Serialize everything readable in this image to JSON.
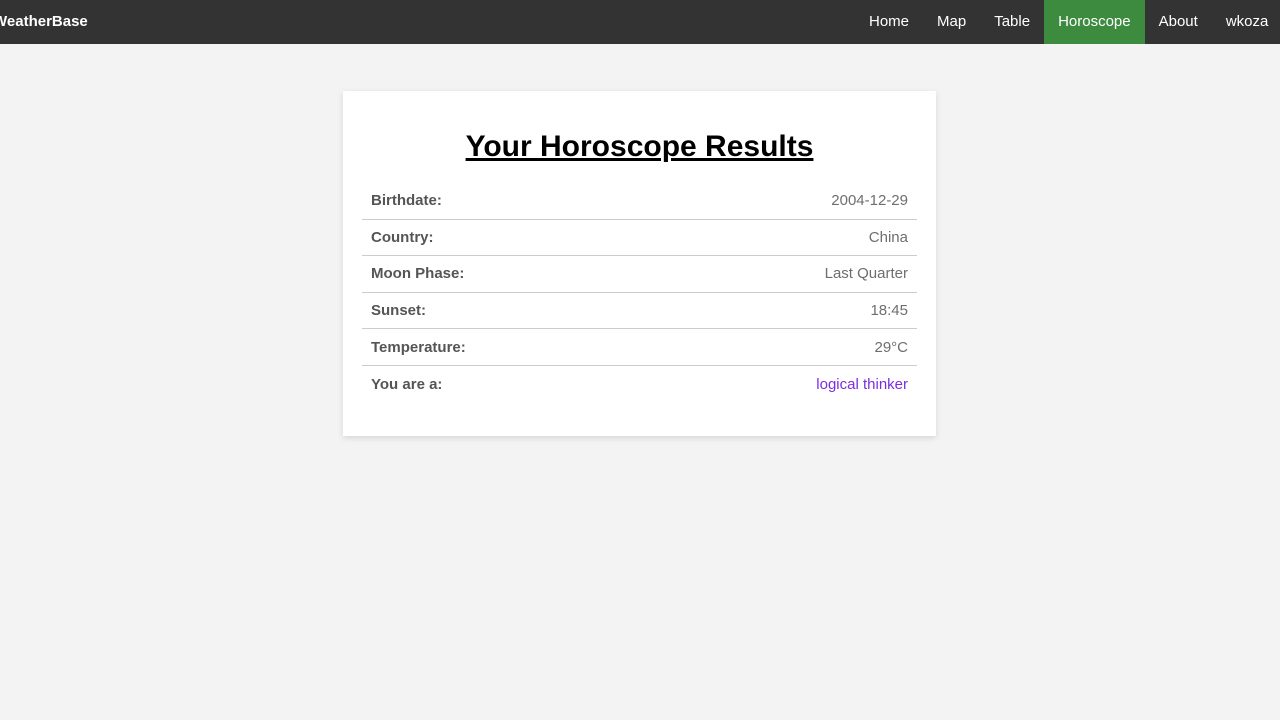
{
  "nav": {
    "brand": "WeatherBase",
    "links": [
      {
        "label": "Home",
        "active": false
      },
      {
        "label": "Map",
        "active": false
      },
      {
        "label": "Table",
        "active": false
      },
      {
        "label": "Horoscope",
        "active": true
      },
      {
        "label": "About",
        "active": false
      },
      {
        "label": "wkoza",
        "active": false
      }
    ]
  },
  "results": {
    "title": "Your Horoscope Results",
    "rows": [
      {
        "label": "Birthdate:",
        "value": "2004-12-29"
      },
      {
        "label": "Country:",
        "value": "China"
      },
      {
        "label": "Moon Phase:",
        "value": "Last Quarter"
      },
      {
        "label": "Sunset:",
        "value": "18:45"
      },
      {
        "label": "Temperature:",
        "value": "29°C"
      },
      {
        "label": "You are a:",
        "value": "logical thinker"
      }
    ]
  },
  "colors": {
    "navbar": "#333333",
    "active_tab": "#3c8b3f",
    "highlight_value": "#7b2ee0",
    "background": "#f3f3f3"
  }
}
